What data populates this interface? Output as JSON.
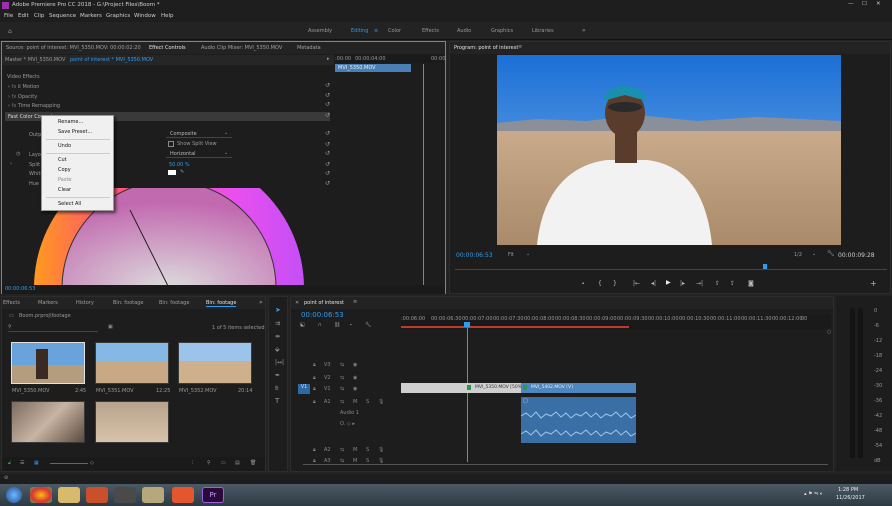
{
  "window": {
    "title": "Adobe Premiere Pro CC 2018 - G:\\Project Files\\Boom *"
  },
  "menu": [
    "File",
    "Edit",
    "Clip",
    "Sequence",
    "Markers",
    "Graphics",
    "Window",
    "Help"
  ],
  "workspaces": [
    "Assembly",
    "Editing",
    "Color",
    "Effects",
    "Audio",
    "Graphics",
    "Libraries"
  ],
  "source": {
    "tabs": [
      "Source: point of interest: MVI_5350.MOV: 00:00:02:20",
      "Effect Controls",
      "Audio Clip Mixer: MVI_5350.MOV",
      "Metadata"
    ],
    "master": "Master * MVI_5350.MOV",
    "clip": "point of interest * MVI_5350.MOV",
    "ruler": [
      ":00:00",
      "00:00:04:00",
      "00:00"
    ],
    "clip_label": "MVI_5350.MOV",
    "section": "Video Effects",
    "rows": [
      "Motion",
      "Opacity",
      "Time Remapping",
      "Fast Color Corrector"
    ],
    "output_label": "Output",
    "output_value": "Composite",
    "show_split": "Show Split View",
    "layout_label": "Layout",
    "layout_value": "Horizontal",
    "split_label": "Split View Percent",
    "split_value": "50.00 %",
    "white_label": "White Balance",
    "hue_label": "Hue Balance",
    "timecode": "00:00:06:53"
  },
  "context_menu": [
    "Rename...",
    "Save Preset...",
    "Undo",
    "Cut",
    "Copy",
    "Paste",
    "Clear",
    "Select All"
  ],
  "program": {
    "title": "Program: point of interest",
    "timecode": "00:00:06:53",
    "fit": "Fit",
    "quality": "1/2",
    "duration": "00:00:09:28"
  },
  "project": {
    "tabs": [
      "Effects",
      "Markers",
      "History",
      "Bin: footage",
      "Bin: footage",
      "Bin: footage"
    ],
    "path": "Boom.prproj\\footage",
    "count": "1 of 5 items selected",
    "clips": [
      {
        "name": "MVI_5350.MOV",
        "dur": "2:45"
      },
      {
        "name": "MVI_5351.MOV",
        "dur": "12:25"
      },
      {
        "name": "MVI_5352.MOV",
        "dur": "20:14"
      }
    ]
  },
  "timeline": {
    "tab": "point of interest",
    "timecode": "00:00:06:53",
    "ruler": [
      ":00:06:00",
      "00:00:06:30",
      "00:00:07:00",
      "00:00:07:30",
      "00:00:08:00",
      "00:00:08:30",
      "00:00:09:00",
      "00:00:09:30",
      "00:00:10:00",
      "00:00:10:30",
      "00:00:11:00",
      "00:00:11:30",
      "00:00:12:00",
      "00"
    ],
    "tracks": [
      "V3",
      "V2",
      "V1",
      "A1",
      "A2",
      "A3"
    ],
    "audio_label": "Audio 1",
    "clip1": "MVI_5350.MOV [50%]",
    "clip2": "MVI_5402.MOV [V]"
  },
  "meter": [
    "0",
    "-6",
    "-12",
    "-18",
    "-24",
    "-30",
    "-36",
    "-42",
    "-48",
    "-54",
    "dB"
  ],
  "tray": {
    "time": "1:28 PM",
    "date": "11/26/2017"
  },
  "colors": {
    "accent": "#2e9cf0",
    "bg": "#232323"
  }
}
